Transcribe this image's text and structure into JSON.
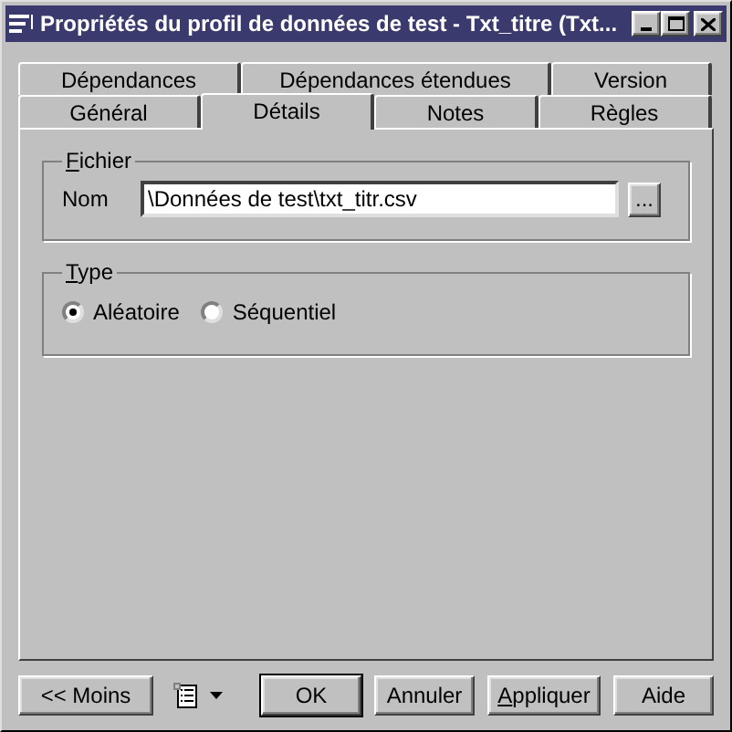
{
  "window": {
    "title": "Propriétés du profil de données de test - Txt_titre (Txt..."
  },
  "tab_rows": [
    {
      "tabs": [
        {
          "label": "Dépendances",
          "selected": false
        },
        {
          "label": "Dépendances étendues",
          "selected": false
        },
        {
          "label": "Version",
          "selected": false
        }
      ]
    },
    {
      "tabs": [
        {
          "label": "Général",
          "selected": false
        },
        {
          "label": "Détails",
          "selected": true
        },
        {
          "label": "Notes",
          "selected": false
        },
        {
          "label": "Règles",
          "selected": false
        }
      ]
    }
  ],
  "fichier": {
    "title": "Fichier",
    "mnemonic": true,
    "label": "Nom",
    "value": "\\Données de test\\txt_titr.csv",
    "browse": "..."
  },
  "type": {
    "title": "Type",
    "mnemonic": true,
    "options": [
      {
        "label": "Aléatoire",
        "selected": true
      },
      {
        "label": "Séquentiel",
        "selected": false
      }
    ]
  },
  "buttons": [
    {
      "label": "<< Moins",
      "kind": "button",
      "default": false
    },
    {
      "kind": "menu"
    },
    {
      "label": "OK",
      "kind": "button",
      "default": true
    },
    {
      "label": "Annuler",
      "kind": "button",
      "default": false
    },
    {
      "label": "Appliquer",
      "kind": "button",
      "mnemonic": true,
      "default": false
    },
    {
      "label": "Aide",
      "kind": "button",
      "default": false
    }
  ]
}
